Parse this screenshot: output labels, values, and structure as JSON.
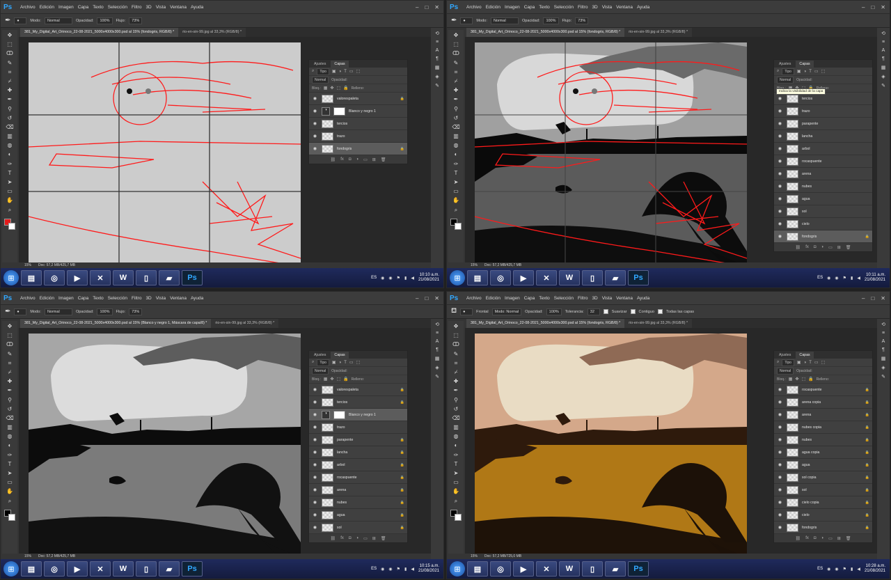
{
  "colors": {
    "ps_blue": "#31a8ff",
    "sketch_red": "#ff1a1a",
    "canvas_gray": "#cccccc",
    "sepia_light": "#e9dcc4",
    "sepia_mid": "#d4a88a",
    "sepia_water": "#b07816",
    "sepia_dark": "#2e1a0c"
  },
  "common": {
    "menu": [
      "Archivo",
      "Edición",
      "Imagen",
      "Capa",
      "Texto",
      "Selección",
      "Filtro",
      "3D",
      "Vista",
      "Ventana",
      "Ayuda"
    ],
    "tab2_label": "rio-en-sin-99.jpg al 33,3% (RGB/8) *",
    "panel_tab_ajustes": "Ajustes",
    "panel_tab_capas": "Capas",
    "filter_kind": "Tipo",
    "blend_mode": "Normal",
    "opacity_label": "Opacidad:",
    "fill_label": "Relleno:",
    "block_label": "Bloq.:",
    "zoom": "15%",
    "brush_icon": "brush-icon",
    "fill_icon": "paint-bucket-icon"
  },
  "quads": [
    {
      "options": {
        "tool_icon": "brush-icon",
        "mode_label": "Modo:",
        "mode": "Normal",
        "opacity_label": "Opacidad:",
        "opacity": "100%",
        "flow_label": "Flujo:",
        "flow": "73%"
      },
      "doc_tab": "381_My_Digital_Art_Orinoco_22-08-2021_5000x4000x300.psd al 15% (fondogris, RGB/8) *",
      "status_doc": "Doc: 57,2 MB/425,7 MB",
      "layers": [
        {
          "name": "valorespaleta",
          "kind": "normal",
          "lock": true
        },
        {
          "name": "Blanco y negro 1",
          "kind": "adjustment",
          "lock": false
        },
        {
          "name": "tercios",
          "kind": "normal",
          "lock": false
        },
        {
          "name": "trazo",
          "kind": "normal",
          "lock": false
        },
        {
          "name": "fondogris",
          "kind": "normal",
          "lock": true,
          "selected": true
        }
      ],
      "tooltip": "",
      "clock_time": "10:10 a.m.",
      "clock_date": "21/08/2021"
    },
    {
      "options": {
        "tool_icon": "brush-icon",
        "mode_label": "Modo:",
        "mode": "Normal",
        "opacity_label": "Opacidad:",
        "opacity": "100%",
        "flow_label": "Flujo:",
        "flow": "73%"
      },
      "doc_tab": "381_My_Digital_Art_Orinoco_22-08-2021_5000x4000x300.psd al 15% (fondogris, RGB/8) *",
      "status_doc": "Doc: 57,2 MB/425,7 MB",
      "layers": [
        {
          "name": "tercios",
          "kind": "normal",
          "lock": false
        },
        {
          "name": "trazo",
          "kind": "normal",
          "lock": false
        },
        {
          "name": "parapente",
          "kind": "normal",
          "lock": false
        },
        {
          "name": "lancha",
          "kind": "normal",
          "lock": false
        },
        {
          "name": "arbol",
          "kind": "normal",
          "lock": false
        },
        {
          "name": "rocaspuente",
          "kind": "normal",
          "lock": false
        },
        {
          "name": "arena",
          "kind": "normal",
          "lock": false
        },
        {
          "name": "nubes",
          "kind": "normal",
          "lock": false
        },
        {
          "name": "agua",
          "kind": "normal",
          "lock": false
        },
        {
          "name": "sol",
          "kind": "normal",
          "lock": false
        },
        {
          "name": "cielo",
          "kind": "normal",
          "lock": false
        },
        {
          "name": "fondogris",
          "kind": "normal",
          "lock": true,
          "selected": true
        }
      ],
      "tooltip": "Indica la visibilidad de la capa",
      "clock_time": "10:11 a.m.",
      "clock_date": "21/08/2021"
    },
    {
      "options": {
        "tool_icon": "brush-icon",
        "mode_label": "Modo:",
        "mode": "Normal",
        "opacity_label": "Opacidad:",
        "opacity": "100%",
        "flow_label": "Flujo:",
        "flow": "73%"
      },
      "doc_tab": "381_My_Digital_Art_Orinoco_22-08-2021_5000x4000x300.psd al 15% (Blanco y negro 1, Máscara de capa/8) *",
      "status_doc": "Doc: 57,2 MB/425,7 MB",
      "layers": [
        {
          "name": "valorespaleta",
          "kind": "normal",
          "lock": true
        },
        {
          "name": "tercios",
          "kind": "normal",
          "lock": true
        },
        {
          "name": "Blanco y negro 1",
          "kind": "adjustment",
          "lock": false,
          "selected": true
        },
        {
          "name": "trazo",
          "kind": "normal",
          "lock": false
        },
        {
          "name": "parapente",
          "kind": "normal",
          "lock": true
        },
        {
          "name": "lancha",
          "kind": "normal",
          "lock": true
        },
        {
          "name": "arbol",
          "kind": "normal",
          "lock": true
        },
        {
          "name": "rocaspuente",
          "kind": "normal",
          "lock": true
        },
        {
          "name": "arena",
          "kind": "normal",
          "lock": true
        },
        {
          "name": "nubes",
          "kind": "normal",
          "lock": true
        },
        {
          "name": "agua",
          "kind": "normal",
          "lock": true
        },
        {
          "name": "sol",
          "kind": "normal",
          "lock": true
        }
      ],
      "tooltip": "",
      "clock_time": "10:15 a.m.",
      "clock_date": "21/08/2021"
    },
    {
      "options": {
        "tool_icon": "paint-bucket-icon",
        "mode_label": "Frontal",
        "mode": "Modo: Normal",
        "opacity_label": "Opacidad:",
        "opacity": "100%",
        "flow_label": "Tolerancia:",
        "flow": "32",
        "extra": [
          "Suavizar",
          "Contiguo",
          "Todas las capas"
        ]
      },
      "doc_tab": "381_My_Digital_Art_Orinoco_22-08-2021_5000x4000x300.psd al 15% (fondogris, RGB/8) *",
      "status_doc": "Doc: 57,2 MB/725,0 MB",
      "layers": [
        {
          "name": "rocaspuente",
          "kind": "normal",
          "lock": true
        },
        {
          "name": "arena copia",
          "kind": "normal",
          "lock": true
        },
        {
          "name": "arena",
          "kind": "normal",
          "lock": true
        },
        {
          "name": "nubes copia",
          "kind": "normal",
          "lock": true
        },
        {
          "name": "nubes",
          "kind": "normal",
          "lock": true
        },
        {
          "name": "agua copia",
          "kind": "normal",
          "lock": true
        },
        {
          "name": "agua",
          "kind": "normal",
          "lock": true
        },
        {
          "name": "sol copia",
          "kind": "normal",
          "lock": true
        },
        {
          "name": "sol",
          "kind": "normal",
          "lock": true
        },
        {
          "name": "cielo copia",
          "kind": "normal",
          "lock": true
        },
        {
          "name": "cielo",
          "kind": "normal",
          "lock": true
        },
        {
          "name": "fondogris",
          "kind": "normal",
          "lock": true
        }
      ],
      "tooltip": "",
      "clock_time": "10:28 a.m.",
      "clock_date": "21/08/2021"
    }
  ],
  "taskbar": {
    "lang": "ES",
    "apps": [
      "start-orb-icon",
      "folder-icon",
      "chrome-icon",
      "media-player-icon",
      "excel-icon",
      "word-icon",
      "notepad-icon",
      "blue-book-icon",
      "photoshop-icon"
    ],
    "ps_label": "Ps",
    "word_label": "W"
  }
}
